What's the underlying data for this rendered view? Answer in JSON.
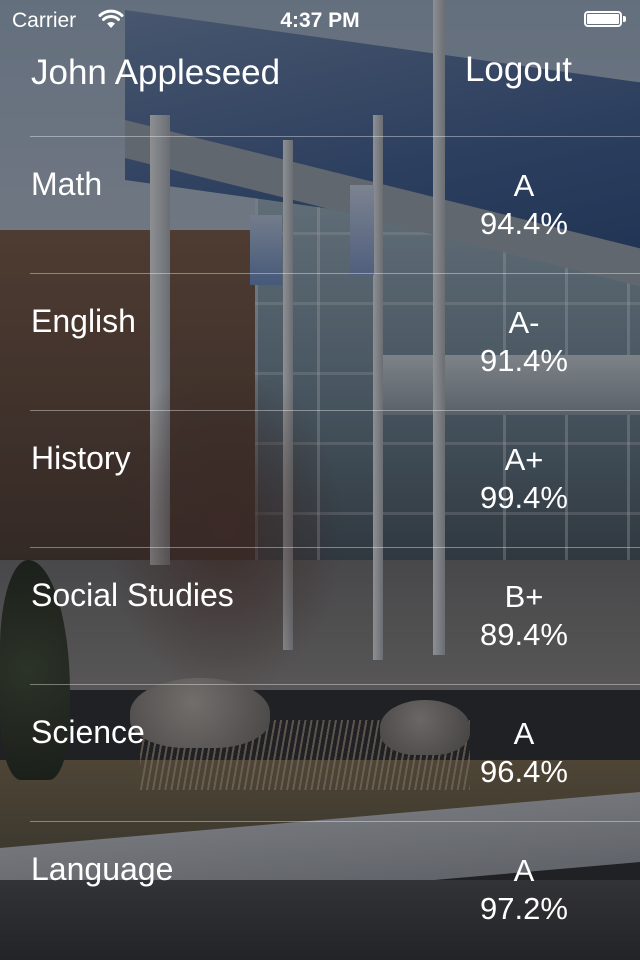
{
  "status_bar": {
    "carrier": "Carrier",
    "time": "4:37 PM",
    "icons": [
      "wifi-icon",
      "battery-icon"
    ]
  },
  "header": {
    "user_name": "John Appleseed",
    "logout_label": "Logout"
  },
  "grades": [
    {
      "subject": "Math",
      "letter": "A",
      "percent": "94.4%"
    },
    {
      "subject": "English",
      "letter": "A-",
      "percent": "91.4%"
    },
    {
      "subject": "History",
      "letter": "A+",
      "percent": "99.4%"
    },
    {
      "subject": "Social Studies",
      "letter": "B+",
      "percent": "89.4%"
    },
    {
      "subject": "Science",
      "letter": "A",
      "percent": "96.4%"
    },
    {
      "subject": "Language",
      "letter": "A",
      "percent": "97.2%"
    }
  ],
  "colors": {
    "text": "#ffffff",
    "divider": "rgba(255,255,255,0.38)"
  }
}
